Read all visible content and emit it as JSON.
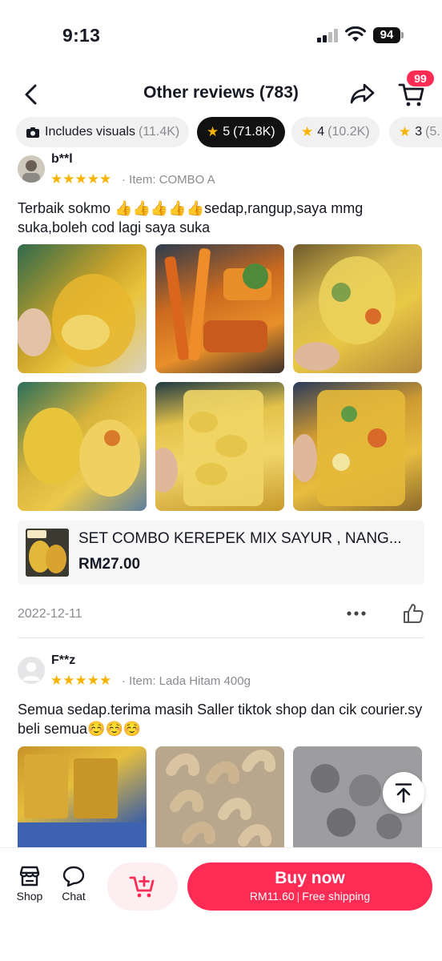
{
  "status_bar": {
    "time": "9:13",
    "battery": "94"
  },
  "header": {
    "title": "Other reviews (783)",
    "cart_badge": "99"
  },
  "filters": [
    {
      "label": "Includes visuals",
      "count": "(11.4K)",
      "icon": "camera-icon"
    },
    {
      "label": "5",
      "count": "(71.8K)",
      "icon": "star-icon",
      "active": true
    },
    {
      "label": "4",
      "count": "(10.2K)",
      "icon": "star-icon"
    },
    {
      "label": "3",
      "count": "(5.",
      "icon": "star-icon"
    }
  ],
  "reviews": [
    {
      "username": "b**l",
      "rating": 5,
      "stars_text": "★★★★★",
      "item": "· Item: COMBO A",
      "text": "Terbaik sokmo 👍👍👍👍👍sedap,rangup,saya mmg suka,boleh cod lagi saya suka",
      "product": {
        "name": "SET COMBO KEREPEK MIX SAYUR , NANG...",
        "price": "RM27.00"
      },
      "date": "2022-12-11"
    },
    {
      "username": "F**z",
      "rating": 5,
      "stars_text": "★★★★★",
      "item": "· Item: Lada Hitam 400g",
      "text": "Semua sedap.terima masih Saller tiktok shop dan cik courier.sy beli semua☺️☺️☺️"
    }
  ],
  "bottom_bar": {
    "shop_label": "Shop",
    "chat_label": "Chat",
    "buy_label": "Buy now",
    "buy_price": "RM11.60",
    "buy_shipping": "Free shipping"
  },
  "colors": {
    "accent": "#fe2c55",
    "star": "#f8b200",
    "muted": "#8a8b91"
  }
}
